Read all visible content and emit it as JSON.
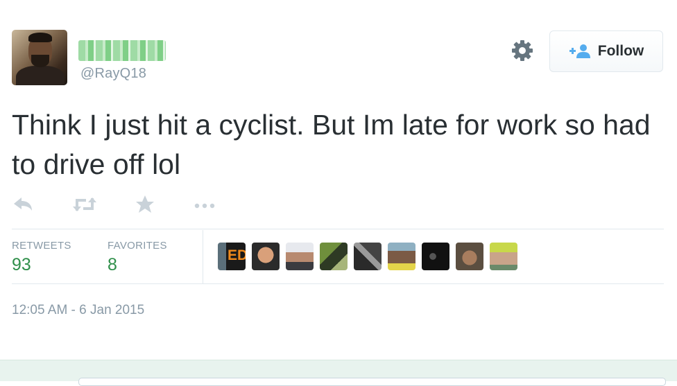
{
  "tweet": {
    "handle": "@RayQ18",
    "text": "Think I just hit a cyclist. But Im late for work so had to drive off lol",
    "timestamp": "12:05 AM - 6 Jan 2015"
  },
  "follow_button": {
    "label": "Follow",
    "icon": "add-user-icon"
  },
  "header_icons": {
    "settings": "gear-icon"
  },
  "actions": [
    "reply-icon",
    "retweet-icon",
    "favorite-icon",
    "more-icon"
  ],
  "stats": {
    "retweets": {
      "label": "RETWEETS",
      "count": "93"
    },
    "favorites": {
      "label": "FAVORITES",
      "count": "8"
    }
  },
  "favoriter_avatars": [
    {
      "name": "favoriter-avatar-1",
      "badge": "ED"
    },
    {
      "name": "favoriter-avatar-2"
    },
    {
      "name": "favoriter-avatar-3"
    },
    {
      "name": "favoriter-avatar-4"
    },
    {
      "name": "favoriter-avatar-5"
    },
    {
      "name": "favoriter-avatar-6"
    },
    {
      "name": "favoriter-avatar-7"
    },
    {
      "name": "favoriter-avatar-8"
    },
    {
      "name": "favoriter-avatar-9"
    }
  ],
  "colors": {
    "text": "#292f33",
    "muted": "#8899a6",
    "count_green": "#2f8f4a",
    "follow_icon_blue": "#55acee",
    "border": "#e1e8ed"
  }
}
